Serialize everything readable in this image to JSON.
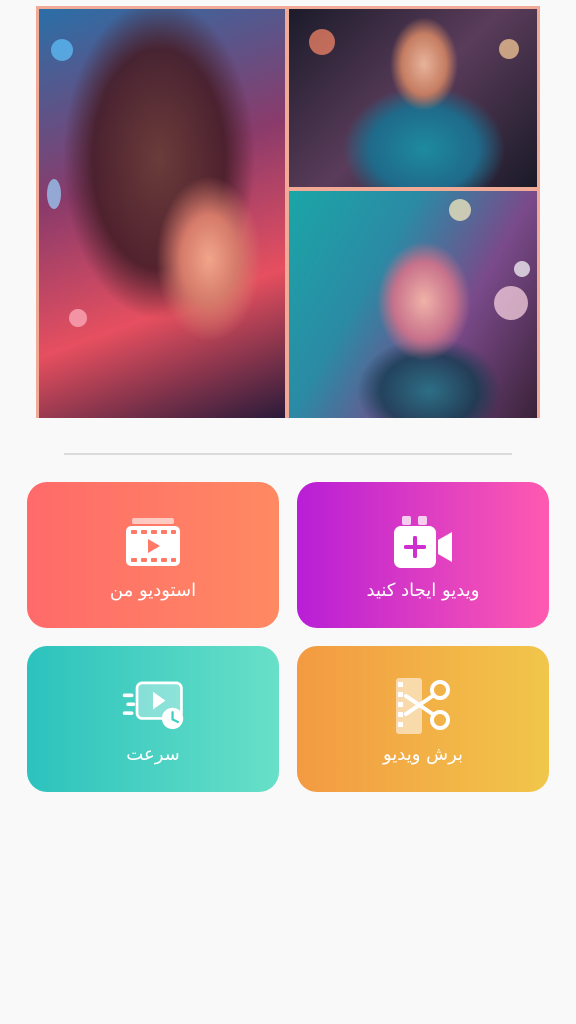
{
  "collage": {
    "photos": [
      {
        "name": "collage-photo-left"
      },
      {
        "name": "collage-photo-top-right"
      },
      {
        "name": "collage-photo-bottom-right"
      }
    ]
  },
  "actions": {
    "my_studio": {
      "label": "استودیو من",
      "icon": "film-clapper-icon",
      "color_start": "#ff6a6a",
      "color_end": "#ff8a62"
    },
    "create_video": {
      "label": "ویدیو ایجاد کنید",
      "icon": "video-plus-icon",
      "color_start": "#b81ed6",
      "color_end": "#ff5ab0"
    },
    "speed": {
      "label": "سرعت",
      "icon": "speed-play-icon",
      "color_start": "#2cc2bd",
      "color_end": "#68e0c8"
    },
    "trim_video": {
      "label": "برش ویدیو",
      "icon": "scissors-film-icon",
      "color_start": "#f39a42",
      "color_end": "#f1c64a"
    }
  }
}
